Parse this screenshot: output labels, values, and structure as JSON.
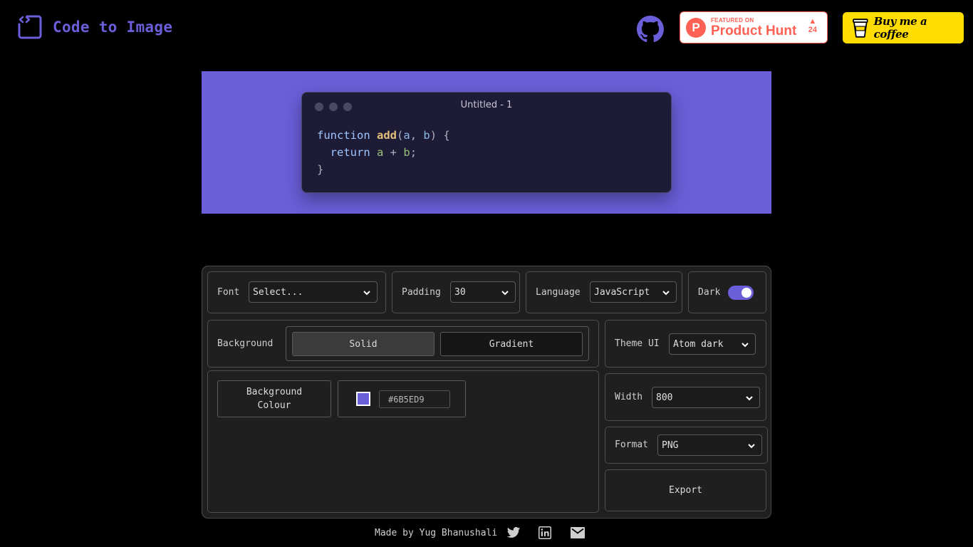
{
  "header": {
    "logo_text": "Code to Image",
    "github_icon": "github-icon",
    "product_hunt": {
      "featured": "FEATURED ON",
      "name": "Product Hunt",
      "letter": "P",
      "votes": "24",
      "color": "#ff6154"
    },
    "buy_coffee": "Buy me a coffee"
  },
  "preview": {
    "background": "#6b5ed9",
    "window_title": "Untitled - 1",
    "code": [
      {
        "tokens": [
          {
            "t": "function ",
            "c": "kw"
          },
          {
            "t": "add",
            "c": "fn"
          },
          {
            "t": "(",
            "c": "p"
          },
          {
            "t": "a",
            "c": "pm"
          },
          {
            "t": ", ",
            "c": "p"
          },
          {
            "t": "b",
            "c": "pm"
          },
          {
            "t": ") {",
            "c": "p"
          }
        ]
      },
      {
        "tokens": [
          {
            "t": "  return ",
            "c": "kw"
          },
          {
            "t": "a",
            "c": "vr"
          },
          {
            "t": " + ",
            "c": "p"
          },
          {
            "t": "b",
            "c": "vr"
          },
          {
            "t": ";",
            "c": "p"
          }
        ]
      },
      {
        "tokens": [
          {
            "t": "}",
            "c": "p"
          }
        ]
      }
    ]
  },
  "controls": {
    "font": {
      "label": "Font",
      "value": "Select..."
    },
    "padding": {
      "label": "Padding",
      "value": "30"
    },
    "language": {
      "label": "Language",
      "value": "JavaScript"
    },
    "dark": {
      "label": "Dark",
      "on": true
    },
    "background": {
      "label": "Background",
      "options": [
        "Solid",
        "Gradient"
      ],
      "selected": "Solid"
    },
    "theme_ui": {
      "label": "Theme UI",
      "value": "Atom dark"
    },
    "width": {
      "label": "Width",
      "value": "800"
    },
    "format": {
      "label": "Format",
      "value": "PNG"
    },
    "background_colour": {
      "label_line1": "Background",
      "label_line2": "Colour",
      "value": "#6B5ED9"
    },
    "export": "Export"
  },
  "footer": {
    "text": "Made by Yug Bhanushali",
    "icons": [
      "twitter-icon",
      "linkedin-icon",
      "mail-icon"
    ]
  },
  "colors": {
    "accent": "#6b5ed9",
    "panel": "#1f1f1f",
    "window": "#1d1b36"
  }
}
